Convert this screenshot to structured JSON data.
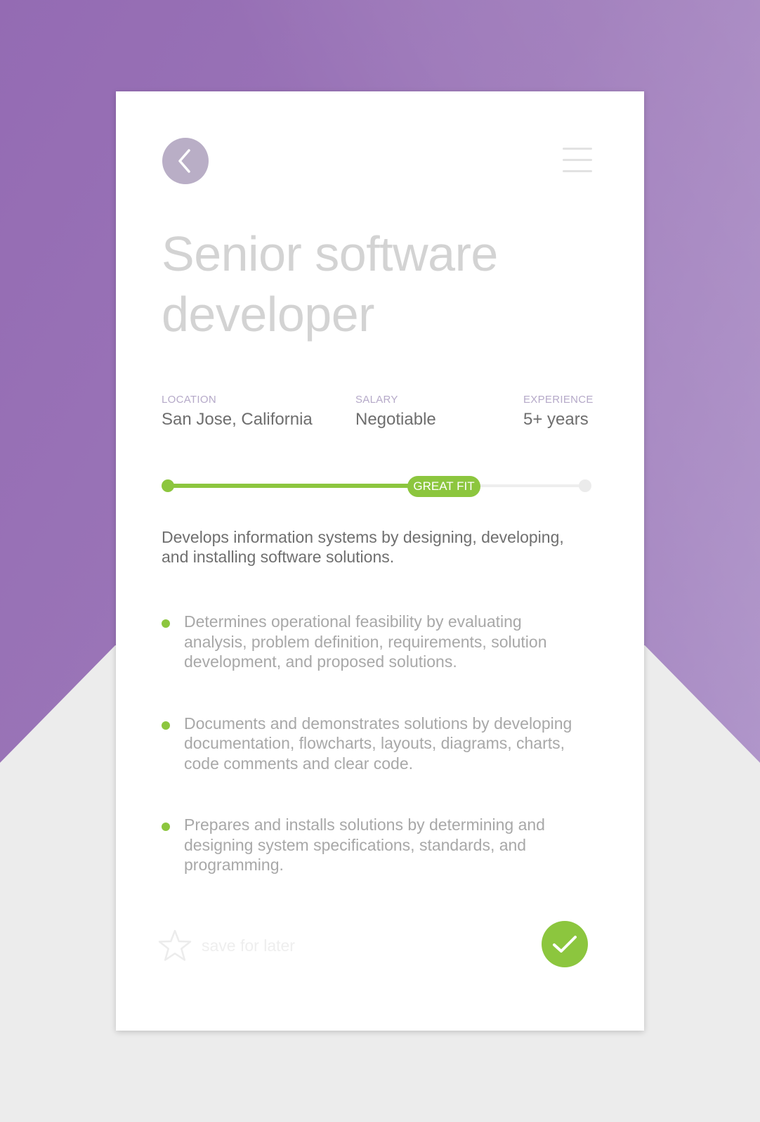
{
  "job": {
    "title": "Senior software developer",
    "details": [
      {
        "label": "LOCATION",
        "value": "San Jose, California"
      },
      {
        "label": "SALARY",
        "value": "Negotiable"
      },
      {
        "label": "EXPERIENCE",
        "value": "5+ years"
      }
    ],
    "fit": {
      "label": "GREAT FIT",
      "progress": 0.6
    },
    "summary": "Develops information systems by designing, developing, and installing software solutions.",
    "responsibilities": [
      "Determines operational feasibility by evaluating analysis, problem definition, requirements, solution development, and proposed solutions.",
      "Documents and demonstrates solutions by developing documentation, flowcharts, layouts, diagrams, charts, code comments and clear code.",
      "Prepares and installs solutions by determining and designing system specifications, standards, and programming."
    ]
  },
  "footer": {
    "save_label": "save for later"
  },
  "icons": {
    "back": "chevron-left-icon",
    "menu": "hamburger-menu-icon",
    "save": "star-icon",
    "confirm": "checkmark-icon"
  },
  "colors": {
    "accent": "#8cc63e",
    "purple": "#9b76b8",
    "back_button": "#b9aec6"
  }
}
